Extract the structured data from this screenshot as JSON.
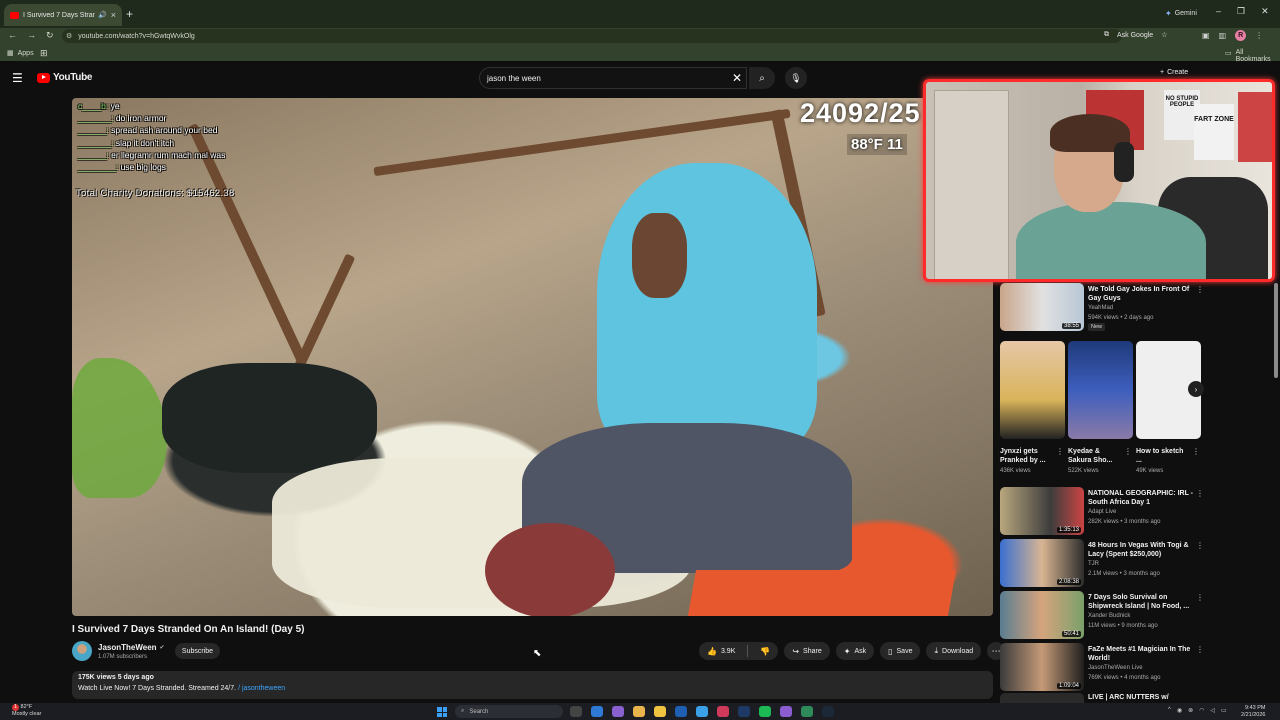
{
  "browser": {
    "tab_title": "I Survived 7 Days Stranded",
    "new_tab": "+",
    "gemini": "Gemini",
    "url": "youtube.com/watch?v=hGwtqWvkOlg",
    "ask_google": "Ask Google",
    "profile_initial": "R",
    "bookmarks_apps": "Apps",
    "all_bookmarks": "All Bookmarks"
  },
  "youtube": {
    "logo_text": "YouTube",
    "search_value": "jason the ween",
    "create_label": "Create"
  },
  "video_overlay": {
    "chat": [
      {
        "user": "c____b:",
        "msg": "ye"
      },
      {
        "user": "_______:",
        "msg": "do iron armor"
      },
      {
        "user": "______:",
        "msg": "spread ash around your bed"
      },
      {
        "user": "_______:",
        "msg": "slap it don't itch"
      },
      {
        "user": "______:",
        "msg": "er llegramr rum mach mal was"
      },
      {
        "user": "________:",
        "msg": "use big logs"
      }
    ],
    "charity": "Total Charity Donations: $15462.38",
    "counter": "24092/25",
    "temperature": "88°F 11"
  },
  "webcam": {
    "poster_text_1": "NO STUPID PEOPLE",
    "poster_text_2": "FART ZONE"
  },
  "video": {
    "title": "I Survived 7 Days Stranded On An Island! (Day 5)",
    "channel": "JasonTheWeen",
    "subscribers": "1.07M subscribers",
    "subscribe_label": "Subscribe",
    "likes": "3.9K",
    "share_label": "Share",
    "ask_label": "Ask",
    "save_label": "Save",
    "download_label": "Download",
    "views_date": "175K views  5 days ago",
    "description": "Watch Live Now! 7 Days Stranded. Streamed 24/7.",
    "description_link": "/ jasontheween"
  },
  "sidebar": {
    "rec_top": {
      "title": "We Told Gay Jokes In Front Of Gay Guys",
      "channel": "YeahMad",
      "meta": "594K views • 2 days ago",
      "duration": "38:55",
      "badge": "New"
    },
    "shorts": [
      {
        "title": "Jynxzi gets Pranked by ...",
        "views": "436K views"
      },
      {
        "title": "Kyedae & Sakura Sho...",
        "views": "522K views"
      },
      {
        "title": "How to sketch ...",
        "views": "49K views"
      }
    ],
    "recs": [
      {
        "title": "NATIONAL GEOGRAPHIC: IRL - South Africa Day 1",
        "channel": "Adapt Live",
        "meta": "282K views • 3 months ago",
        "duration": "1:35:13"
      },
      {
        "title": "48 Hours In Vegas With Togi & Lacy (Spent $250,000)",
        "channel": "TJR",
        "meta": "2.1M views • 3 months ago",
        "duration": "2:08:38"
      },
      {
        "title": "7 Days Solo Survival on Shipwreck Island | No Food, ...",
        "channel": "Xander Budnick",
        "meta": "11M views • 9 months ago",
        "duration": "50:41"
      },
      {
        "title": "FaZe Meets #1 Magician In The World!",
        "channel": "JasonTheWeen Live",
        "meta": "769K views • 4 months ago",
        "duration": "1:09:04"
      },
      {
        "title": "LIVE | ARC NUTTERS w/",
        "channel": "",
        "meta": "",
        "duration": ""
      }
    ]
  },
  "taskbar": {
    "weather_temp": "82°F",
    "weather_desc": "Mostly clear",
    "search_placeholder": "Search",
    "time": "9:43 PM",
    "date": "2/21/2026"
  },
  "colors": {
    "accent_red": "#ff0000",
    "webcam_border": "#ff2a2a",
    "link_blue": "#3ea6ff"
  }
}
